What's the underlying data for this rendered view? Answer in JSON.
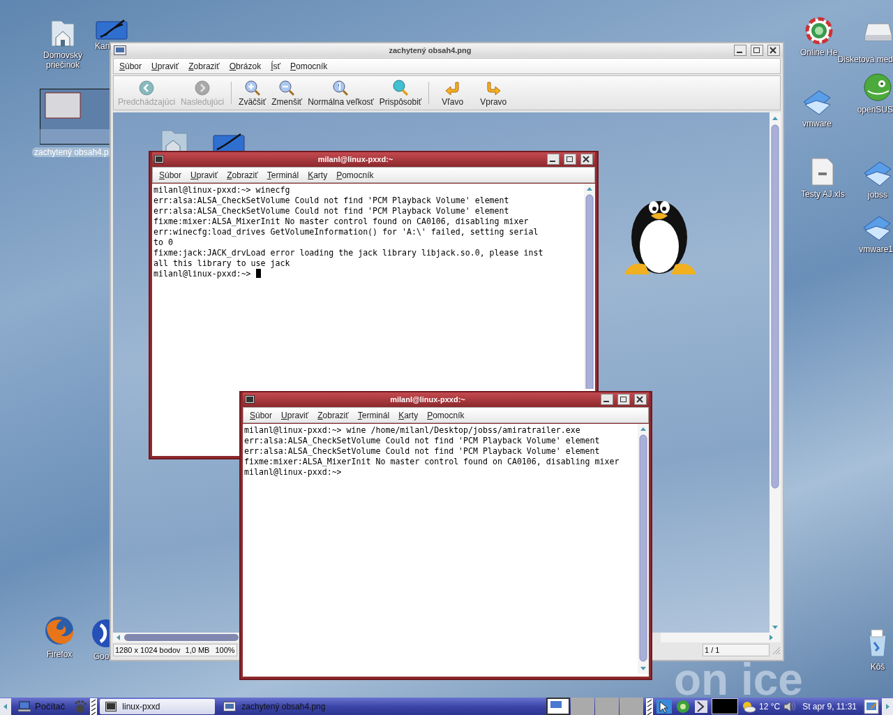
{
  "desktop": {
    "icons": [
      {
        "label": "Domovský priečinok",
        "kind": "home"
      },
      {
        "label": "Kan",
        "kind": "office"
      },
      {
        "label": "Firefox",
        "kind": "firefox"
      },
      {
        "label": "Goo",
        "kind": "google"
      },
      {
        "label": "Online He",
        "kind": "help"
      },
      {
        "label": "Disketová med",
        "kind": "drive"
      },
      {
        "label": "openSUS",
        "kind": "suse"
      },
      {
        "label": "vmware",
        "kind": "folder"
      },
      {
        "label": "Testy AJ.xls",
        "kind": "document"
      },
      {
        "label": "jobss",
        "kind": "folder"
      },
      {
        "label": "vmware1",
        "kind": "folder"
      },
      {
        "label": "Kôš",
        "kind": "trash"
      }
    ],
    "thumbnail": {
      "label": "zachytený obsah4.p"
    },
    "wallpaper_text": "on ice"
  },
  "image_viewer": {
    "title": "zachytený obsah4.png",
    "menu": [
      "Súbor",
      "Upraviť",
      "Zobraziť",
      "Obrázok",
      "Ísť",
      "Pomocník"
    ],
    "toolbar": [
      {
        "label": "Predchádzajúci",
        "kind": "prev",
        "disabled": true
      },
      {
        "label": "Nasledujúci",
        "kind": "next",
        "disabled": true
      },
      {
        "label": "Zväčšiť",
        "kind": "zoom_in",
        "disabled": false
      },
      {
        "label": "Zmenšiť",
        "kind": "zoom_out",
        "disabled": false
      },
      {
        "label": "Normálna veľkosť",
        "kind": "zoom_1",
        "disabled": false
      },
      {
        "label": "Prispôsobiť",
        "kind": "fit",
        "disabled": false
      },
      {
        "label": "Vľavo",
        "kind": "rotate_left",
        "disabled": false
      },
      {
        "label": "Vpravo",
        "kind": "rotate_right",
        "disabled": false
      }
    ],
    "status": {
      "dimensions": "1280 x 1024 bodov",
      "file_size": "1,0 MB",
      "zoom": "100%",
      "page": "1 / 1"
    }
  },
  "terminals": [
    {
      "title": "milanl@linux-pxxd:~",
      "menu": [
        "Súbor",
        "Upraviť",
        "Zobraziť",
        "Terminál",
        "Karty",
        "Pomocník"
      ],
      "cursor": true,
      "lines": [
        "milanl@linux-pxxd:~> winecfg",
        "err:alsa:ALSA_CheckSetVolume Could not find 'PCM Playback Volume' element",
        "err:alsa:ALSA_CheckSetVolume Could not find 'PCM Playback Volume' element",
        "fixme:mixer:ALSA_MixerInit No master control found on CA0106, disabling mixer",
        "err:winecfg:load_drives GetVolumeInformation() for 'A:\\' failed, setting serial",
        "to 0",
        "fixme:jack:JACK_drvLoad error loading the jack library libjack.so.0, please inst",
        "all this library to use jack",
        "milanl@linux-pxxd:~> "
      ]
    },
    {
      "title": "milanl@linux-pxxd:~",
      "menu": [
        "Súbor",
        "Upraviť",
        "Zobraziť",
        "Terminál",
        "Karty",
        "Pomocník"
      ],
      "cursor": false,
      "lines": [
        "milanl@linux-pxxd:~> wine /home/milanl/Desktop/jobss/amiratrailer.exe",
        "err:alsa:ALSA_CheckSetVolume Could not find 'PCM Playback Volume' element",
        "err:alsa:ALSA_CheckSetVolume Could not find 'PCM Playback Volume' element",
        "fixme:mixer:ALSA_MixerInit No master control found on CA0106, disabling mixer",
        "milanl@linux-pxxd:~>"
      ]
    }
  ],
  "taskbar": {
    "start_label": "Počítač",
    "tasks": [
      {
        "label": "linux-pxxd",
        "kind": "terminal",
        "selected": true
      },
      {
        "label": "zachytený obsah4.png",
        "kind": "image",
        "selected": false
      }
    ],
    "pager": [
      {
        "selected": true
      },
      {
        "selected": false
      },
      {
        "selected": false
      },
      {
        "selected": false
      }
    ],
    "weather": "12 °C",
    "clock": "St apr 9, 11:31"
  }
}
